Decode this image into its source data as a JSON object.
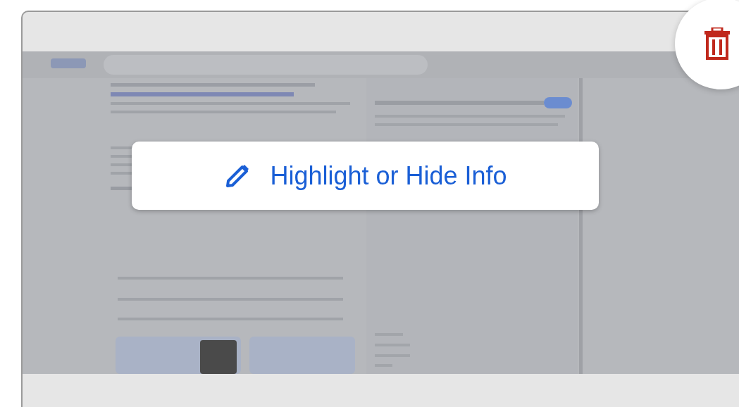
{
  "overlay_button": {
    "label": "Highlight or Hide Info"
  }
}
